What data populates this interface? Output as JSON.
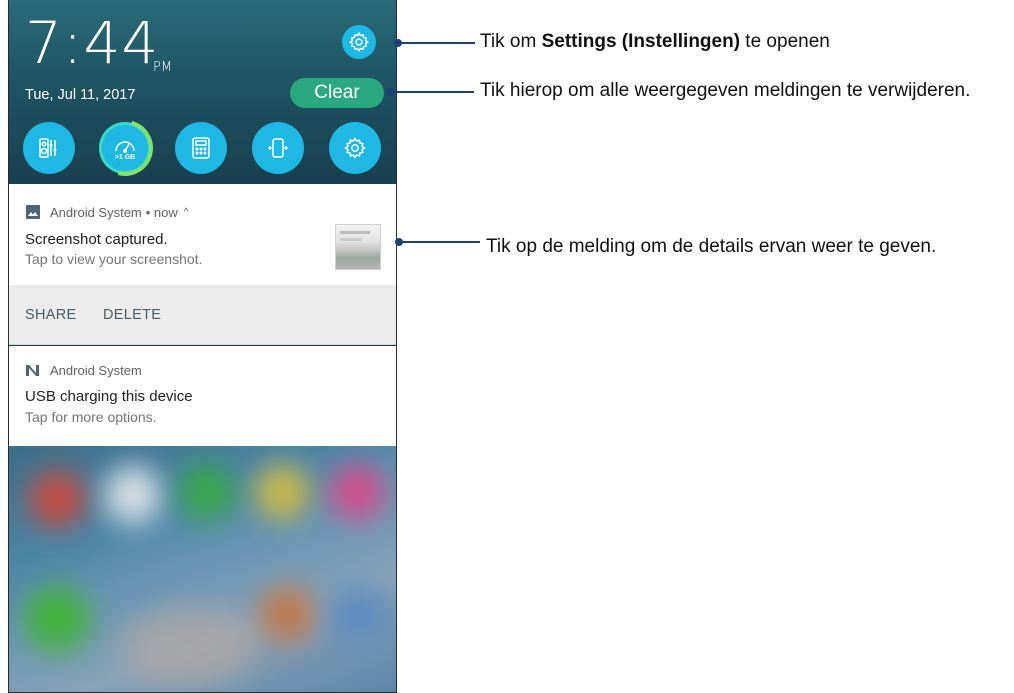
{
  "status": {
    "time": "7:44",
    "ampm": "PM",
    "date": "Tue, Jul 11, 2017"
  },
  "header": {
    "clear_label": "Clear"
  },
  "quick_settings": [
    {
      "icon": "audio-wizard-icon",
      "label": ""
    },
    {
      "icon": "boost-icon",
      "label": ">1 GB"
    },
    {
      "icon": "calculator-icon",
      "label": ""
    },
    {
      "icon": "auto-rotate-icon",
      "label": ""
    },
    {
      "icon": "settings-icon",
      "label": ""
    }
  ],
  "notifications": [
    {
      "app": "Android System",
      "meta": "• now",
      "title": "Screenshot captured.",
      "body": "Tap to view your screenshot.",
      "actions": [
        "SHARE",
        "DELETE"
      ]
    },
    {
      "app": "Android System",
      "title": "USB charging this device",
      "body": "Tap for more options."
    }
  ],
  "callouts": {
    "settings_pre": "Tik om ",
    "settings_bold": "Settings (Instellingen)",
    "settings_post": " te openen",
    "clear": "Tik hierop om alle weergegeven meldingen te verwijderen.",
    "notification": "Tik op de melding om de details ervan weer te geven."
  },
  "colors": {
    "accent_blue": "#1fb7e3",
    "clear_green": "#2aa87f",
    "callout_line": "#1d3f7a"
  }
}
